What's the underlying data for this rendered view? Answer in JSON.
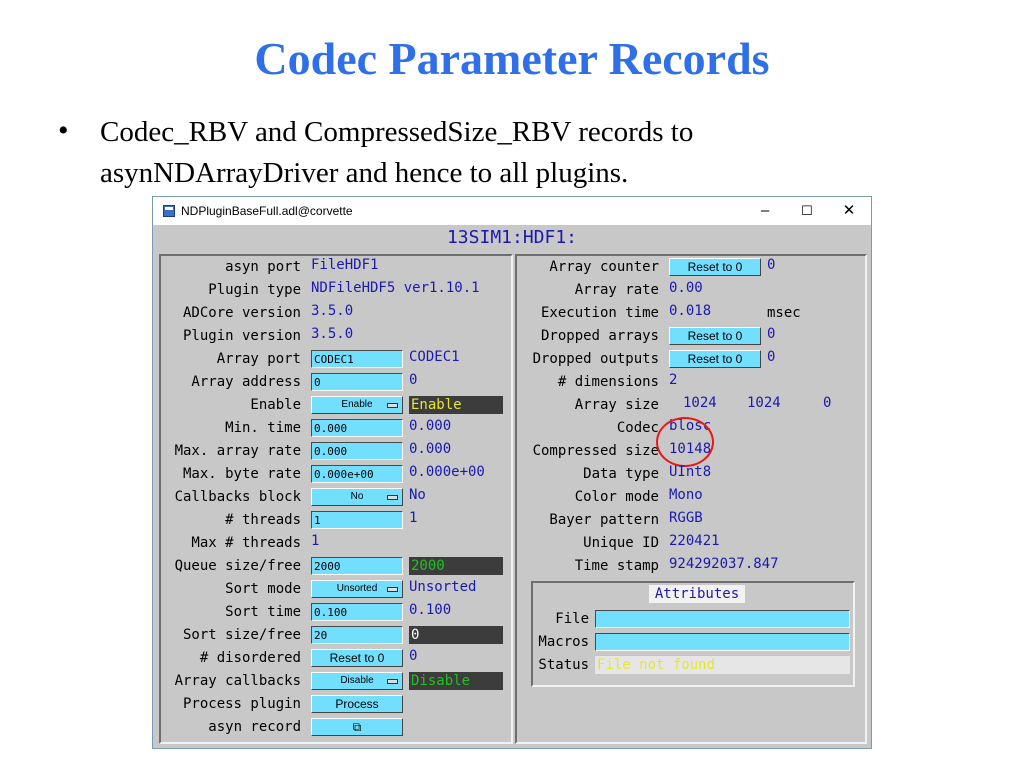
{
  "slide": {
    "title": "Codec Parameter Records",
    "bullet": "Codec_RBV and CompressedSize_RBV records to asynNDArrayDriver and hence to all plugins."
  },
  "window": {
    "title": "NDPluginBaseFull.adl@corvette",
    "minimize": "–",
    "maximize": "☐",
    "close": "✕",
    "screen_title": "13SIM1:HDF1:"
  },
  "left": {
    "asyn_port": {
      "label": "asyn port",
      "value": "FileHDF1"
    },
    "plugin_type": {
      "label": "Plugin type",
      "value": "NDFileHDF5 ver1.10.1"
    },
    "adcore_version": {
      "label": "ADCore version",
      "value": "3.5.0"
    },
    "plugin_version": {
      "label": "Plugin version",
      "value": "3.5.0"
    },
    "array_port": {
      "label": "Array port",
      "input": "CODEC1",
      "value": "CODEC1"
    },
    "array_address": {
      "label": "Array address",
      "input": "0",
      "value": "0"
    },
    "enable": {
      "label": "Enable",
      "menu": "Enable",
      "value": "Enable"
    },
    "min_time": {
      "label": "Min. time",
      "input": "0.000",
      "value": "0.000"
    },
    "max_array_rate": {
      "label": "Max. array rate",
      "input": "0.000",
      "value": "0.000"
    },
    "max_byte_rate": {
      "label": "Max. byte rate",
      "input": "0.000e+00",
      "value": "0.000e+00"
    },
    "callbacks_block": {
      "label": "Callbacks block",
      "menu": "No",
      "value": "No"
    },
    "threads": {
      "label": "# threads",
      "input": "1",
      "value": "1"
    },
    "max_threads": {
      "label": "Max # threads",
      "value": "1"
    },
    "queue_size": {
      "label": "Queue size/free",
      "input": "2000",
      "value": "2000"
    },
    "sort_mode": {
      "label": "Sort mode",
      "menu": "Unsorted",
      "value": "Unsorted"
    },
    "sort_time": {
      "label": "Sort time",
      "input": "0.100",
      "value": "0.100"
    },
    "sort_size": {
      "label": "Sort size/free",
      "input": "20",
      "value": "0"
    },
    "disordered": {
      "label": "# disordered",
      "button": "Reset to 0",
      "value": "0"
    },
    "array_callbacks": {
      "label": "Array callbacks",
      "menu": "Disable",
      "value": "Disable"
    },
    "process_plugin": {
      "label": "Process plugin",
      "button": "Process"
    },
    "asyn_record": {
      "label": "asyn record",
      "button": "⧉"
    }
  },
  "right": {
    "array_counter": {
      "label": "Array counter",
      "button": "Reset to 0",
      "value": "0"
    },
    "array_rate": {
      "label": "Array rate",
      "value": "0.00"
    },
    "execution_time": {
      "label": "Execution time",
      "value": "0.018",
      "unit": "msec"
    },
    "dropped_arrays": {
      "label": "Dropped arrays",
      "button": "Reset to 0",
      "value": "0"
    },
    "dropped_outputs": {
      "label": "Dropped outputs",
      "button": "Reset to 0",
      "value": "0"
    },
    "dimensions": {
      "label": "# dimensions",
      "value": "2"
    },
    "array_size": {
      "label": "Array size",
      "values": [
        "1024",
        "1024",
        "0"
      ]
    },
    "codec": {
      "label": "Codec",
      "value": "blosc"
    },
    "compressed_size": {
      "label": "Compressed size",
      "value": "10148"
    },
    "data_type": {
      "label": "Data type",
      "value": "UInt8"
    },
    "color_mode": {
      "label": "Color mode",
      "value": "Mono"
    },
    "bayer_pattern": {
      "label": "Bayer pattern",
      "value": "RGGB"
    },
    "unique_id": {
      "label": "Unique ID",
      "value": "220421"
    },
    "time_stamp": {
      "label": "Time stamp",
      "value": "924292037.847"
    }
  },
  "attributes": {
    "title": "Attributes",
    "file": {
      "label": "File",
      "input": ""
    },
    "macros": {
      "label": "Macros",
      "input": ""
    },
    "status": {
      "label": "Status",
      "value": "File not found"
    }
  },
  "colors": {
    "title_blue": "#2f6fe8",
    "input_cyan": "#73dfff",
    "value_blue": "#1a1ab0",
    "panel_gray": "#c8c8c8",
    "highlight_red": "#e81818"
  }
}
